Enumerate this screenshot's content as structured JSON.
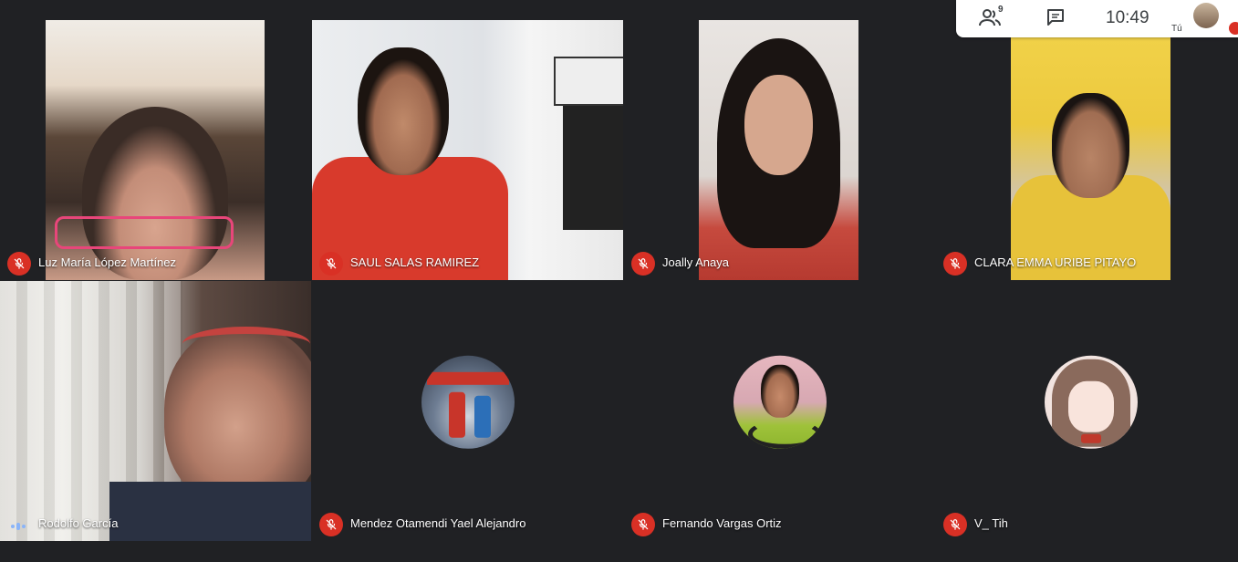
{
  "meeting": {
    "participant_count": "9",
    "clock": "10:49",
    "self_label": "Tú"
  },
  "participants": [
    {
      "name": "Luz María López Martínez",
      "muted": true
    },
    {
      "name": "SAUL SALAS RAMIREZ",
      "muted": true
    },
    {
      "name": "Joally Anaya",
      "muted": true
    },
    {
      "name": "CLARA EMMA URIBE PITAYO",
      "muted": true
    },
    {
      "name": "Rodolfo García",
      "muted": false,
      "speaking": true
    },
    {
      "name": "Mendez Otamendi Yael Alejandro",
      "muted": true,
      "camera": "off"
    },
    {
      "name": "Fernando Vargas Ortiz",
      "muted": true,
      "camera": "off"
    },
    {
      "name": "V_ Tih",
      "muted": true,
      "camera": "off"
    }
  ],
  "icons": {
    "people": "people-icon",
    "chat": "chat-icon",
    "mic_off": "mic-off-icon",
    "speaking": "speaking-indicator-icon"
  },
  "colors": {
    "background": "#202124",
    "muted_red": "#d93025",
    "speaking_blue": "#8ab4f8"
  }
}
